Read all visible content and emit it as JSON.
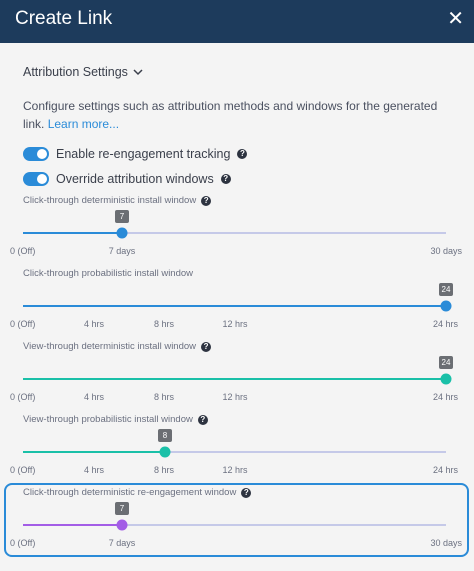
{
  "header": {
    "title": "Create Link",
    "close_icon": "close-icon"
  },
  "attribution": {
    "section_label": "Attribution Settings",
    "description": "Configure settings such as attribution methods and windows for the generated link.",
    "learn_more": "Learn more..."
  },
  "toggles": [
    {
      "label": "Enable re-engagement tracking",
      "on": true
    },
    {
      "label": "Override attribution windows",
      "on": true
    }
  ],
  "sliders": [
    {
      "label": "Click-through deterministic install window",
      "value": "7",
      "ticks": [
        "0 (Off)",
        "7 days",
        "30 days"
      ],
      "color": "#2a8bd8",
      "help": true
    },
    {
      "label": "Click-through probabilistic install window",
      "value": "24",
      "ticks": [
        "0 (Off)",
        "4 hrs",
        "8 hrs",
        "12 hrs",
        "24 hrs"
      ],
      "color": "#2a8bd8",
      "help": false
    },
    {
      "label": "View-through deterministic install window",
      "value": "24",
      "ticks": [
        "0 (Off)",
        "4 hrs",
        "8 hrs",
        "12 hrs",
        "24 hrs"
      ],
      "color": "#1ac0a8",
      "help": true
    },
    {
      "label": "View-through probabilistic install window",
      "value": "8",
      "ticks": [
        "0 (Off)",
        "4 hrs",
        "8 hrs",
        "12 hrs",
        "24 hrs"
      ],
      "color": "#1ac0a8",
      "help": true
    },
    {
      "label": "Click-through deterministic re-engagement window",
      "value": "7",
      "ticks": [
        "0 (Off)",
        "7 days",
        "30 days"
      ],
      "color": "#a35de6",
      "help": true
    }
  ],
  "colors": {
    "header_bg": "#1d3b5c",
    "accent_blue": "#2a8bd8",
    "accent_teal": "#1ac0a8",
    "accent_purple": "#a35de6",
    "track_rest": "#c5c9e8"
  }
}
